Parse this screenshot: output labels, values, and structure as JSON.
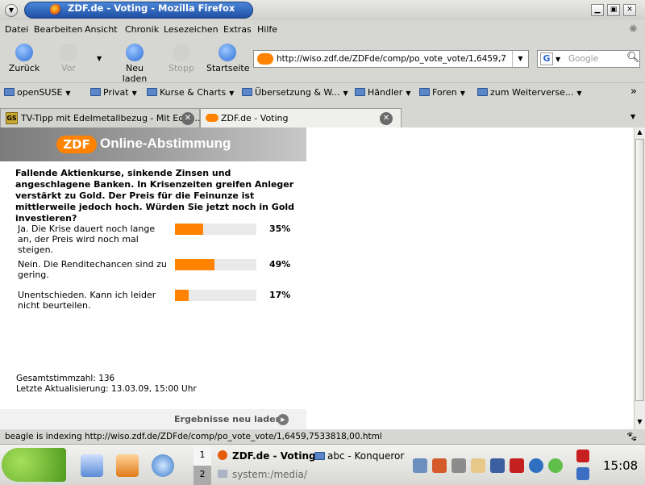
{
  "window": {
    "title": "ZDF.de - Voting - Mozilla Firefox"
  },
  "menubar": [
    "Datei",
    "Bearbeiten",
    "Ansicht",
    "Chronik",
    "Lesezeichen",
    "Extras",
    "Hilfe"
  ],
  "nav": {
    "back": "Zurück",
    "forward": "Vor",
    "reload": "Neu laden",
    "stop": "Stopp",
    "home": "Startseite"
  },
  "urlbar": {
    "value": "http://wiso.zdf.de/ZDFde/comp/po_vote_vote/1,6459,7"
  },
  "search": {
    "placeholder": "Google"
  },
  "bookmarks": [
    "openSUSE",
    "Privat",
    "Kurse & Charts",
    "Übersetzung & W...",
    "Händler",
    "Foren",
    "zum Weiterverse..."
  ],
  "tabs": [
    {
      "label": "TV-Tipp mit Edelmetallbezug - Mit Edel...",
      "active": false
    },
    {
      "label": "ZDF.de - Voting",
      "active": true
    }
  ],
  "page": {
    "logo": "ZDF",
    "header": "Online-Abstimmung",
    "question": "Fallende Aktienkurse, sinkende Zinsen und angeschlagene Banken. In Krisenzeiten greifen Anleger verstärkt zu Gold. Der Preis für die Feinunze ist mittlerweile jedoch hoch. Würden Sie jetzt noch in Gold investieren?",
    "options": [
      {
        "label": "Ja. Die Krise dauert noch lange an, der Preis wird noch mal steigen.",
        "percent_text": "35%",
        "percent": 35
      },
      {
        "label": "Nein. Die Renditechancen sind zu gering.",
        "percent_text": "49%",
        "percent": 49
      },
      {
        "label": "Unentschieden. Kann ich leider nicht beurteilen.",
        "percent_text": "17%",
        "percent": 17
      }
    ],
    "total": "Gesamtstimmzahl: 136",
    "updated": "Letzte Aktualisierung: 13.03.09, 15:00 Uhr",
    "refresh": "Ergebnisse neu laden"
  },
  "statusbar": {
    "text": "beagle is indexing http://wiso.zdf.de/ZDFde/comp/po_vote_vote/1,6459,7533818,00.html"
  },
  "taskbar": {
    "desktops": [
      "1",
      "2"
    ],
    "tasks": [
      "ZDF.de - Voting",
      "abc - Konqueror",
      "system:/media/"
    ],
    "clock": "15:08"
  },
  "colors": {
    "accent": "#ff8200",
    "titlebar": "#2a5db0"
  }
}
